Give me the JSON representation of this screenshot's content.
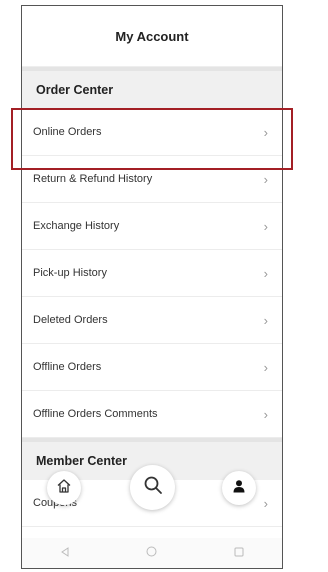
{
  "header": {
    "title": "My Account"
  },
  "order_center": {
    "title": "Order Center",
    "items": [
      {
        "label": "Online Orders"
      },
      {
        "label": "Return & Refund History"
      },
      {
        "label": "Exchange History"
      },
      {
        "label": "Pick-up History"
      },
      {
        "label": "Deleted Orders"
      },
      {
        "label": "Offline Orders"
      },
      {
        "label": "Offline Orders Comments"
      }
    ]
  },
  "member_center": {
    "title": "Member Center",
    "items": [
      {
        "label": "Coupons"
      }
    ]
  },
  "chevron": "›",
  "colors": {
    "highlight": "#a31f25",
    "section_bg": "#f0f0f0"
  },
  "bottom_nav": {
    "icons": [
      "home-icon",
      "search-icon",
      "user-icon"
    ]
  },
  "system_nav": {
    "icons": [
      "back-icon",
      "home-circle-icon",
      "recents-icon"
    ]
  }
}
